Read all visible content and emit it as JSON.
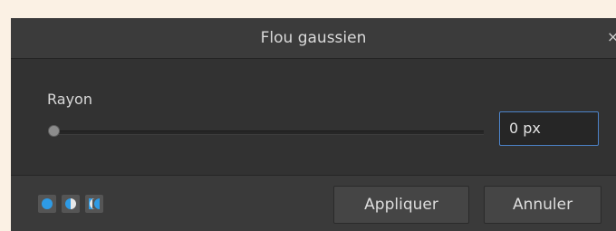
{
  "dialog": {
    "title": "Flou gaussien",
    "close_icon": "close-icon",
    "close_glyph": "×"
  },
  "radius": {
    "label": "Rayon",
    "value": "0 px",
    "slider_level": 0
  },
  "footer": {
    "mode_icons": [
      "blend-mode-full-icon",
      "blend-mode-half-icon",
      "blend-mode-edge-icon"
    ],
    "apply_label": "Appliquer",
    "cancel_label": "Annuler"
  },
  "colors": {
    "accent": "#4c82c8",
    "icon_blue": "#2e9be6",
    "background": "#fbf1e4",
    "panel": "#2f2f2f"
  }
}
